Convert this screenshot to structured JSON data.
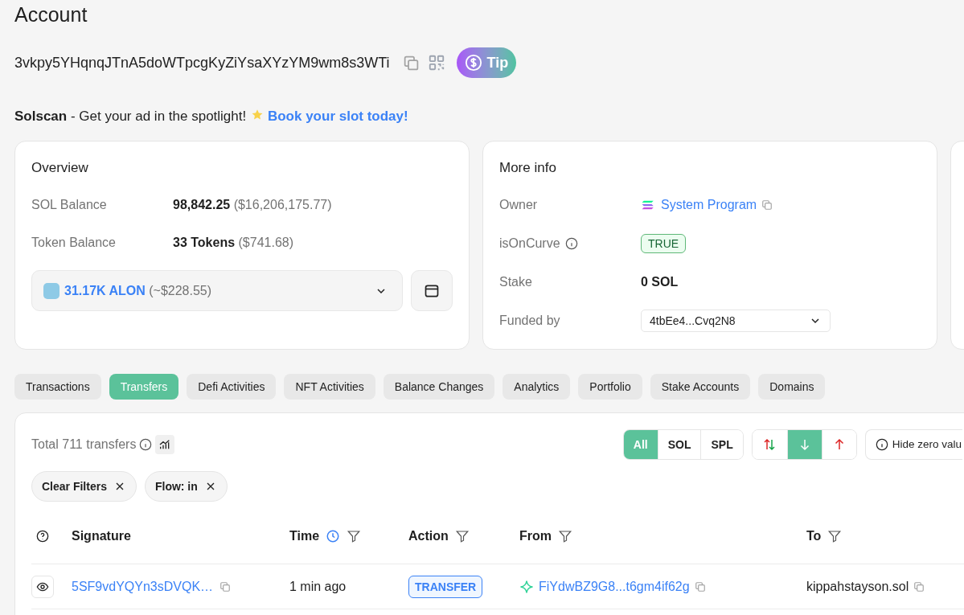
{
  "page": {
    "title": "Account"
  },
  "address": {
    "value": "3vkpy5YHqnqJTnA5doWTpcgKyZiYsaXYzYM9wm8s3WTi",
    "tip_label": "Tip"
  },
  "ad": {
    "brand": "Solscan",
    "text": "- Get your ad in the spotlight!",
    "link": "Book your slot today!"
  },
  "overview": {
    "title": "Overview",
    "rows": [
      {
        "label": "SOL Balance",
        "value": "98,842.25",
        "note": "($16,206,175.77)"
      },
      {
        "label": "Token Balance",
        "value": "33 Tokens",
        "note": "($741.68)"
      }
    ],
    "token_select": {
      "amount": "31.17K ALON",
      "note": "(~$228.55)"
    }
  },
  "more_info": {
    "title": "More info",
    "rows": [
      {
        "kind": "link",
        "label": "Owner",
        "value": "System Program"
      },
      {
        "kind": "badge",
        "label": "isOnCurve",
        "value": "TRUE"
      },
      {
        "kind": "bold",
        "label": "Stake",
        "value": "0 SOL"
      },
      {
        "kind": "select",
        "label": "Funded by",
        "value": "4tbEe4...Cvq2N8"
      }
    ]
  },
  "tabs": [
    {
      "label": "Transactions",
      "selected": false
    },
    {
      "label": "Transfers",
      "selected": true
    },
    {
      "label": "Defi Activities",
      "selected": false
    },
    {
      "label": "NFT Activities",
      "selected": false
    },
    {
      "label": "Balance Changes",
      "selected": false
    },
    {
      "label": "Analytics",
      "selected": false
    },
    {
      "label": "Portfolio",
      "selected": false
    },
    {
      "label": "Stake Accounts",
      "selected": false
    },
    {
      "label": "Domains",
      "selected": false
    }
  ],
  "transfers": {
    "total": "Total 711 transfers",
    "type_filters": [
      {
        "label": "All",
        "selected": true
      },
      {
        "label": "SOL",
        "selected": false
      },
      {
        "label": "SPL",
        "selected": false
      }
    ],
    "flow_filters": [
      {
        "kind": "both",
        "selected": false
      },
      {
        "kind": "in",
        "selected": true
      },
      {
        "kind": "out",
        "selected": false
      }
    ],
    "hide_zero": "Hide zero valu",
    "active_filters": [
      "Clear Filters",
      "Flow: in"
    ],
    "columns": [
      {
        "kind": "plain",
        "label": "Signature"
      },
      {
        "kind": "time",
        "label": "Time"
      },
      {
        "kind": "filter",
        "label": "Action"
      },
      {
        "kind": "filter",
        "label": "From"
      },
      {
        "kind": "filter",
        "label": "To"
      }
    ],
    "rows": [
      {
        "signature": "5SF9vdYQYn3sDVQK…",
        "time": "1 min ago",
        "action": "TRANSFER",
        "from": "FiYdwBZ9G8...t6gm4if62g",
        "to": "kippahstayson.sol"
      }
    ]
  }
}
